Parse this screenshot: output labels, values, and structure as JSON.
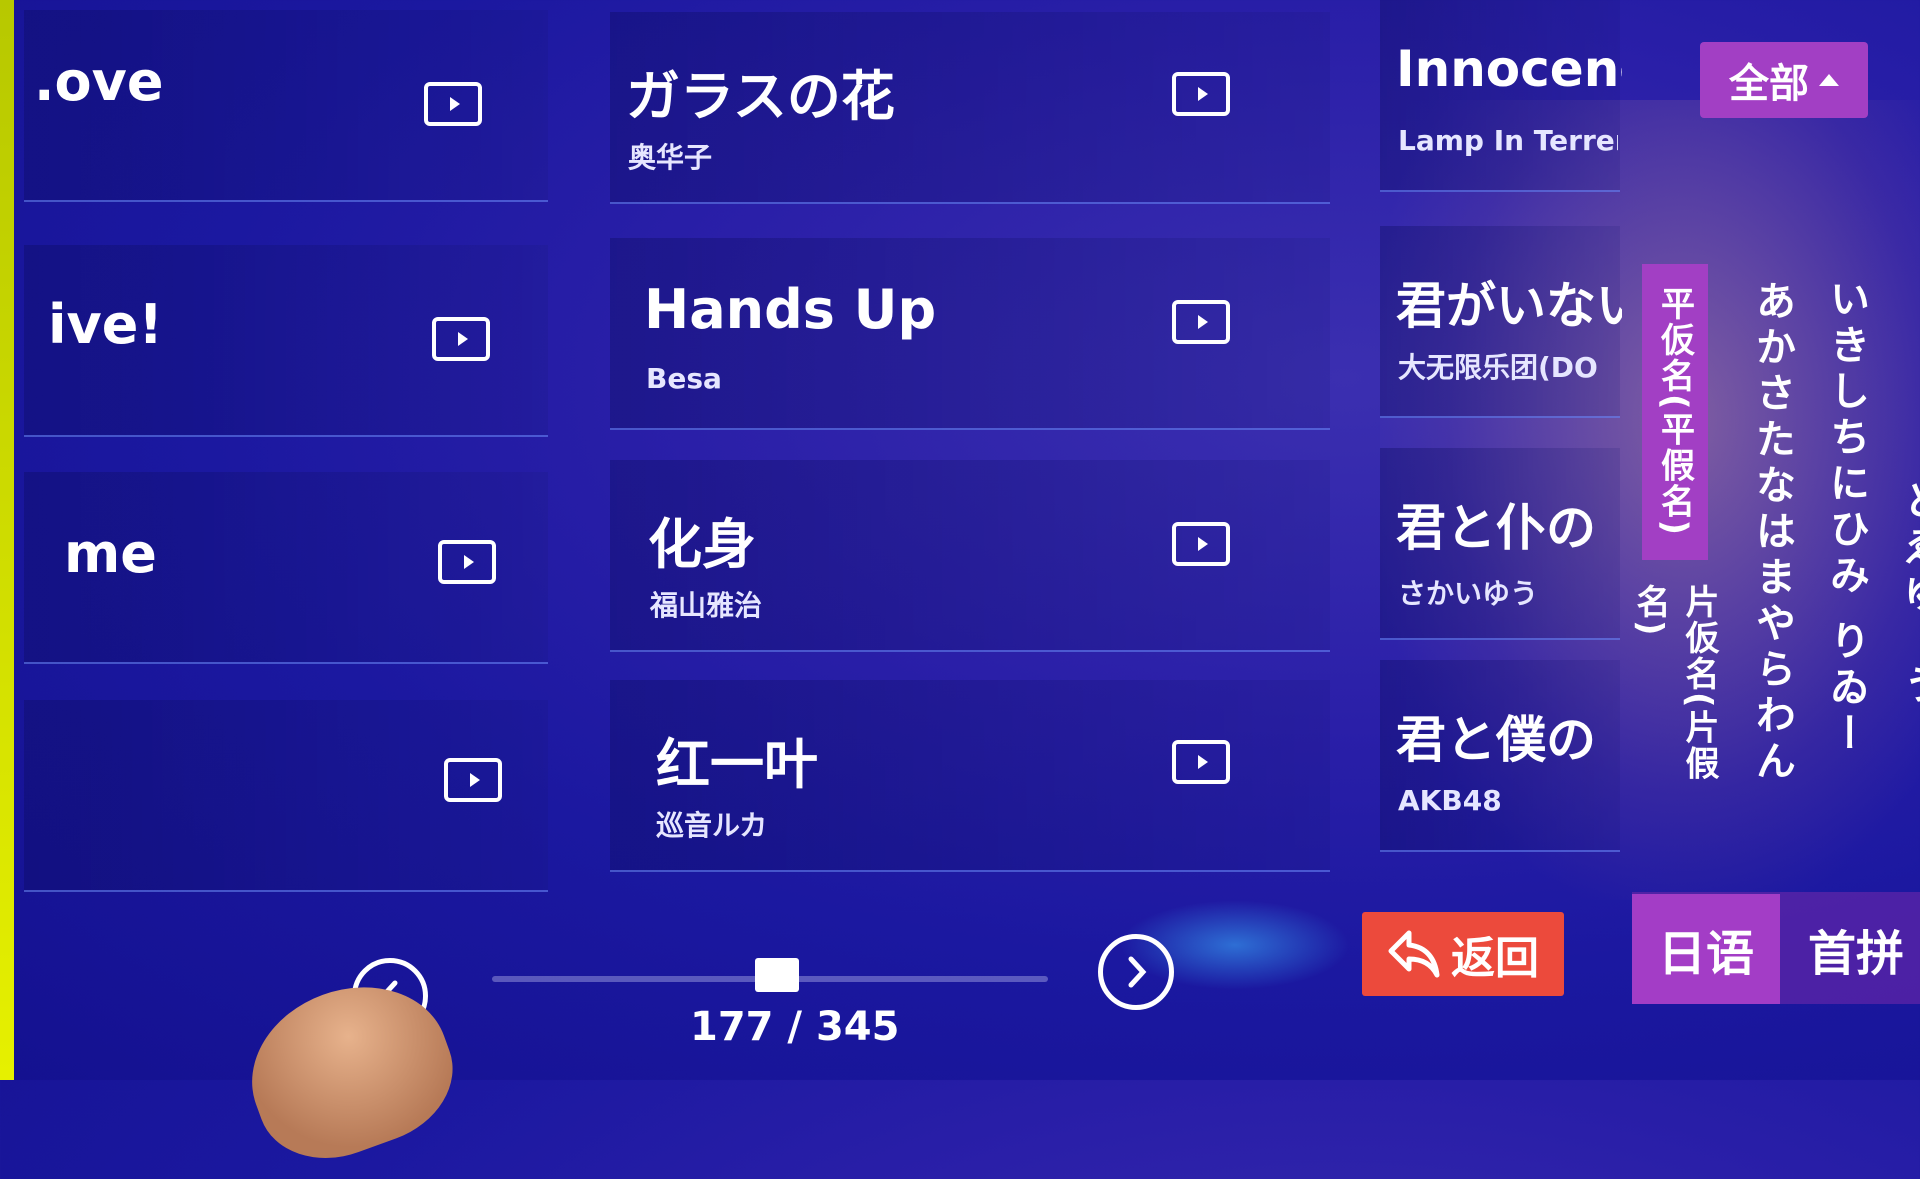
{
  "colors": {
    "accent_purple": "#a23fc4",
    "back_red": "#ec4a3c",
    "background": "#1f1aa5"
  },
  "left_column": [
    {
      "title": ".ove",
      "artist": ""
    },
    {
      "title": "ive!",
      "artist": ""
    },
    {
      "title": "me",
      "artist": ""
    },
    {
      "title": "",
      "artist": ""
    }
  ],
  "middle_column": [
    {
      "title": "ガラスの花",
      "artist": "奥华子"
    },
    {
      "title": "Hands Up",
      "artist": "Besa"
    },
    {
      "title": "化身",
      "artist": "福山雅治"
    },
    {
      "title": "红一叶",
      "artist": "巡音ルカ"
    }
  ],
  "right_column": [
    {
      "title": "Innocenc",
      "artist": "Lamp In Terren"
    },
    {
      "title": "君がいない",
      "artist": "大无限乐团(DO"
    },
    {
      "title": "君と仆の",
      "artist": "さかいゆう"
    },
    {
      "title": "君と僕の",
      "artist": "AKB48"
    }
  ],
  "filter": {
    "label": "全部",
    "icon": "caret-up-icon"
  },
  "tabs": {
    "hiragana": "平仮名(平假名)",
    "katakana": "片仮名(片假名)"
  },
  "kana_index": {
    "col1": "あかさたなはまやらわん",
    "col2": "いきしちにひみ りゐー",
    "col3": "とゑゆーう"
  },
  "language_tabs": {
    "japanese": "日语",
    "pinyin": "首拼"
  },
  "back_button": {
    "label": "返回",
    "icon": "return-arrow-icon"
  },
  "pagination": {
    "current": 177,
    "total": 345,
    "label": "177 / 345",
    "progress_fraction": 0.513
  }
}
